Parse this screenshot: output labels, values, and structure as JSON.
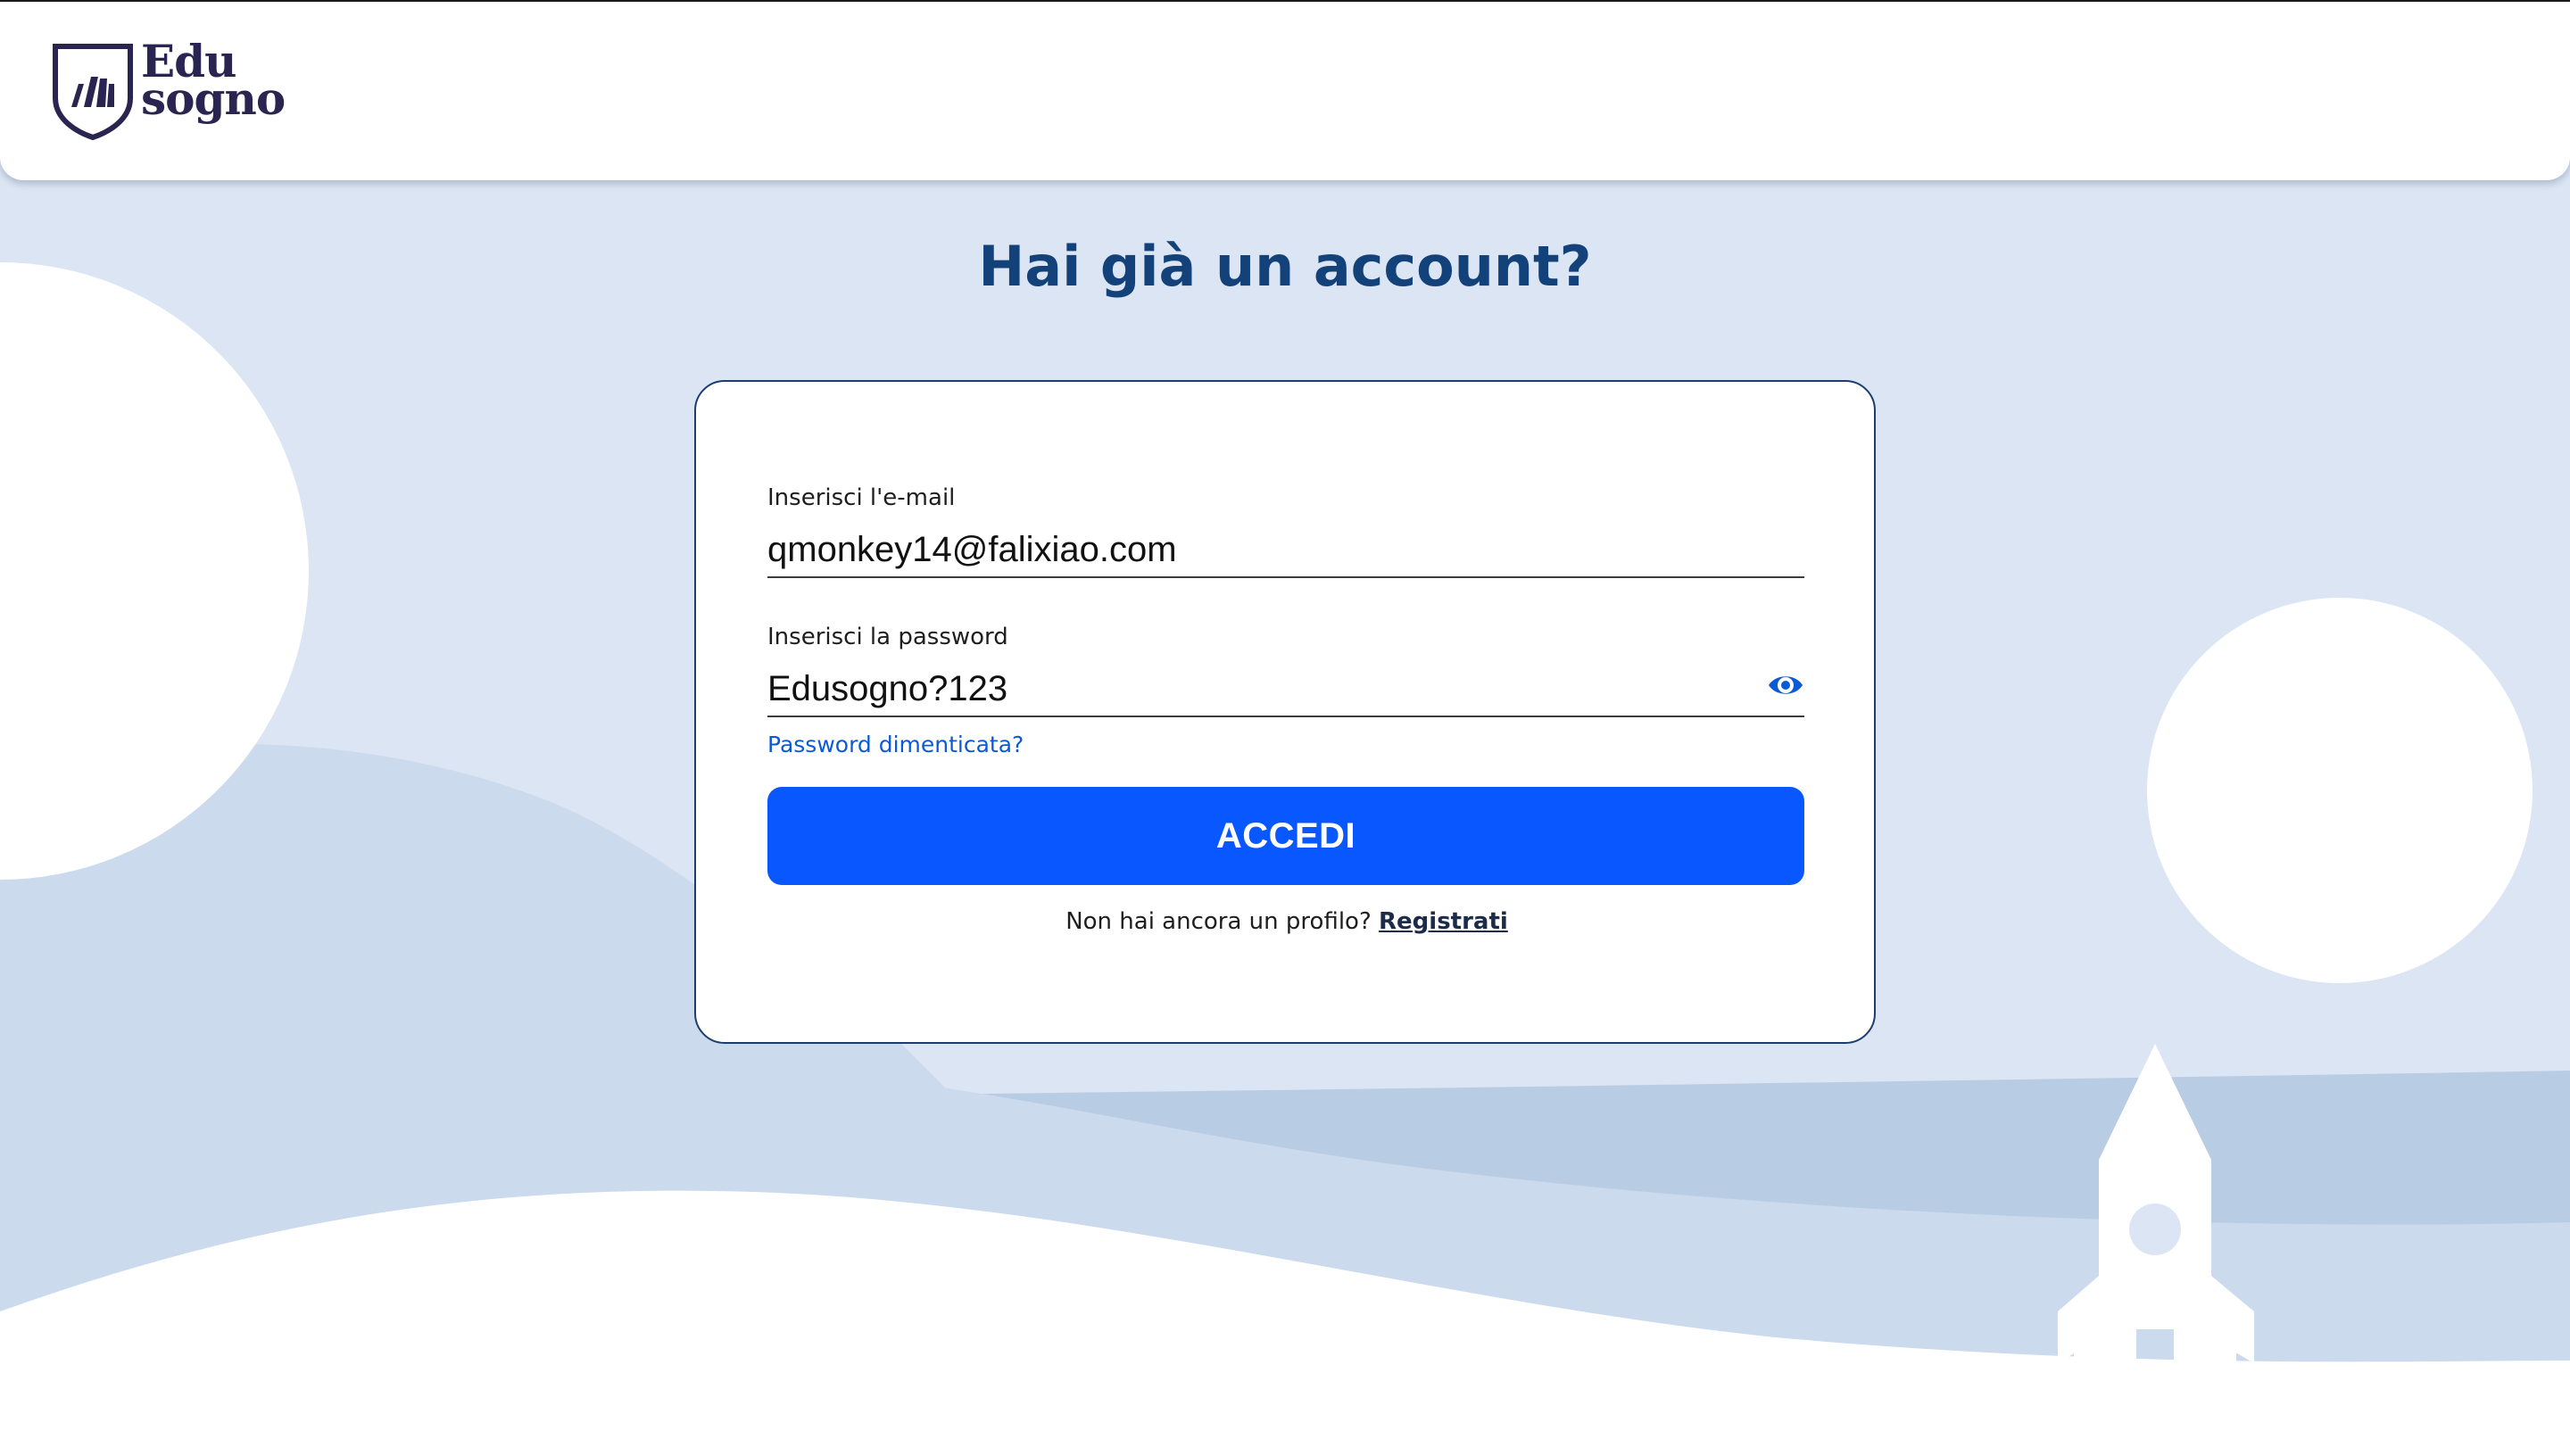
{
  "header": {
    "logo": {
      "line1": "Edu",
      "line2": "sogno"
    }
  },
  "main": {
    "title": "Hai già un account?"
  },
  "login_form": {
    "email": {
      "label": "Inserisci l'e-mail",
      "value": "qmonkey14@falixiao.com"
    },
    "password": {
      "label": "Inserisci la password",
      "value": "Edusogno?123",
      "toggle_icon": "eye-icon"
    },
    "forgot_password": "Password dimenticata?",
    "submit_label": "ACCEDI",
    "register_prompt": "Non hai ancora un profilo?",
    "register_link": "Registrati"
  },
  "colors": {
    "background": "#dbe5f3",
    "primary_button": "#0857ff",
    "title": "#13427a",
    "link": "#0a5ad6"
  }
}
